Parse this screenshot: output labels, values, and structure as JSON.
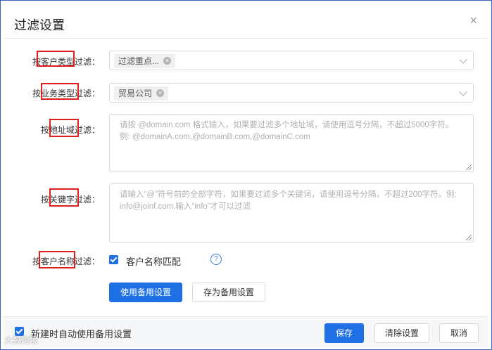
{
  "dialog": {
    "title": "过滤设置",
    "close_symbol": "×"
  },
  "filters": {
    "customer_type": {
      "label": "按客户类型过滤：",
      "tag": "过滤重点..."
    },
    "business_type": {
      "label": "按业务类型过滤：",
      "tag": "贸易公司"
    },
    "address_domain": {
      "label": "按地址域过滤：",
      "placeholder": "请按 @domain.com 格式输入，如果要过滤多个地址域，请使用逗号分隔，不超过5000字符。例: @domainA.com,@domainB.com,@domainC.com"
    },
    "keyword": {
      "label": "按关键字过滤：",
      "placeholder": "请输入“@”符号前的全部字符，如果要过滤多个关键词，请使用逗号分隔，不超过200字符。例: info@joinf.com,输入“info”才可以过滤"
    },
    "customer_name": {
      "label": "按客户名称过滤：",
      "checkbox_label": "客户名称匹配",
      "checked": true,
      "help_symbol": "?"
    }
  },
  "actions": {
    "use_backup": "使用备用设置",
    "save_as_backup": "存为备用设置"
  },
  "footer": {
    "auto_use_label": "新建时自动使用备用设置",
    "auto_use_checked": true,
    "save": "保存",
    "clear": "清除设置",
    "cancel": "取消"
  },
  "watermark": "大数跨境",
  "colors": {
    "primary": "#1f6fe5",
    "highlight_box": "#e02020",
    "frame": "#3a64c8"
  }
}
